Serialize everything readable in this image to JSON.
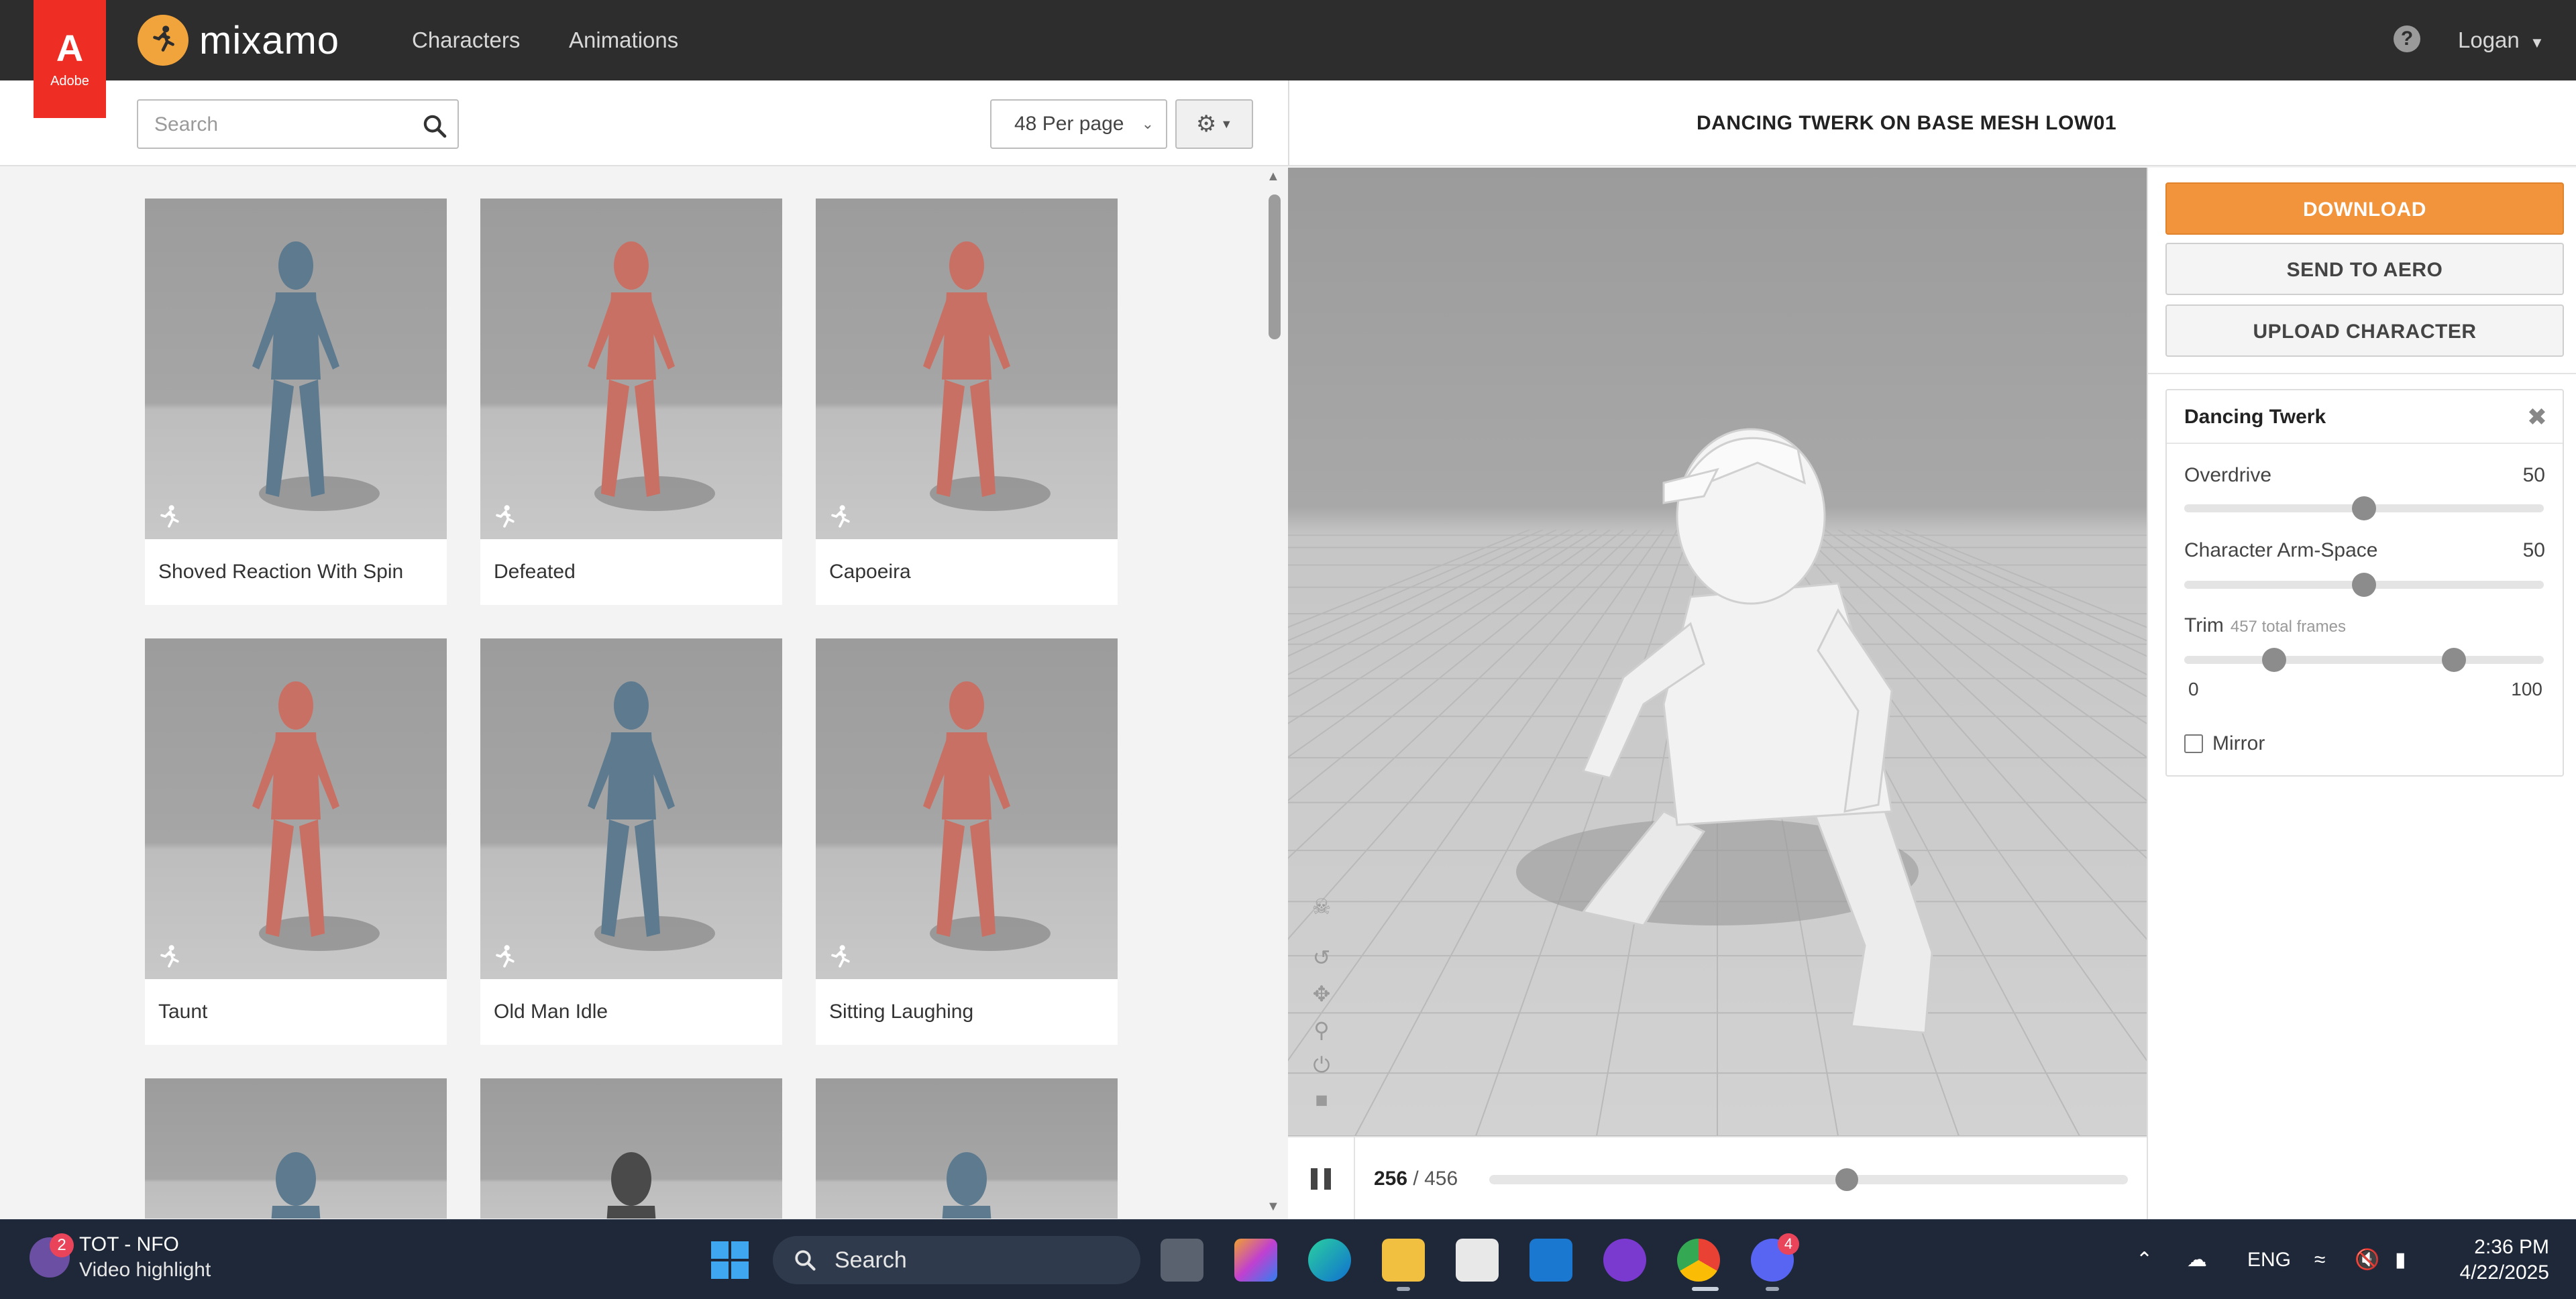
{
  "app": {
    "adobe_label": "Adobe",
    "brand": "mixamo",
    "nav": {
      "characters": "Characters",
      "animations": "Animations"
    },
    "help": "?",
    "user": "Logan"
  },
  "toolbar": {
    "search_placeholder": "Search",
    "per_page": "48 Per page"
  },
  "grid": {
    "cards": [
      {
        "label": "Shoved Reaction With Spin",
        "color": "#5d7a8f"
      },
      {
        "label": "Defeated",
        "color": "#c97064"
      },
      {
        "label": "Capoeira",
        "color": "#c97064"
      },
      {
        "label": "Taunt",
        "color": "#c97064"
      },
      {
        "label": "Old Man Idle",
        "color": "#5d7a8f"
      },
      {
        "label": "Sitting Laughing",
        "color": "#c97064"
      }
    ]
  },
  "viewer": {
    "title": "DANCING TWERK ON BASE MESH LOW01",
    "current_frame": "256",
    "total_frames": "456",
    "progress": 0.56
  },
  "actions": {
    "download": "DOWNLOAD",
    "send_aero": "SEND TO AERO",
    "upload": "UPLOAD CHARACTER"
  },
  "settings": {
    "title": "Dancing Twerk",
    "overdrive": {
      "label": "Overdrive",
      "value": "50",
      "fraction": 0.5
    },
    "arm_space": {
      "label": "Character Arm-Space",
      "value": "50",
      "fraction": 0.5
    },
    "trim": {
      "label": "Trim",
      "sub": "457 total frames",
      "min": "0",
      "max": "100",
      "low": 0.25,
      "high": 0.75
    },
    "mirror": "Mirror"
  },
  "taskbar": {
    "widget_title": "TOT - NFO",
    "widget_sub": "Video highlight",
    "widget_badge": "2",
    "search": "Search",
    "discord_badge": "4",
    "lang": "ENG",
    "time": "2:36 PM",
    "date": "4/22/2025"
  }
}
